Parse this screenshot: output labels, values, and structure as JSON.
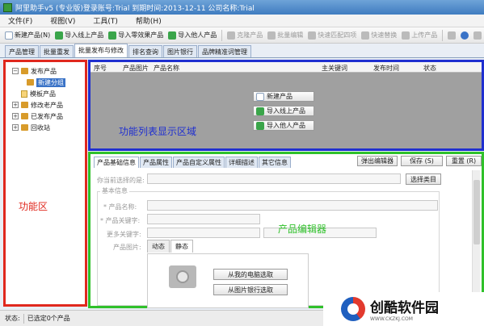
{
  "window": {
    "title": "阿里助手v5 (专业版)登录账号:Trial  到期时间:2013-12-11   公司名称:Trial"
  },
  "menu": [
    "文件(F)",
    "视图(V)",
    "工具(T)",
    "帮助(H)"
  ],
  "toolbar": {
    "new_product": "新建产品(N)",
    "import_online": "导入线上产品",
    "import_effect": "导入零效果产品",
    "import_others": "导入他人产品",
    "clone_product": "克隆产品",
    "batch_edit": "批量编辑",
    "quick_match": "快速匹配四项",
    "quick_replace": "快速替换",
    "upload_product": "上传产品"
  },
  "main_tabs": [
    "产品管理",
    "批量重发",
    "批量发布与修改",
    "排名查询",
    "图片银行",
    "品牌精准词管理"
  ],
  "tree": {
    "items": [
      "发布产品",
      "新建分组",
      "模板产品",
      "修改老产品",
      "已发布产品",
      "回收站"
    ]
  },
  "left_label": "功能区",
  "list": {
    "columns": [
      "序号",
      "产品图片",
      "产品名称",
      "主关键词",
      "发布时间",
      "状态"
    ],
    "buttons": [
      "新建产品",
      "导入线上产品",
      "导入他人产品"
    ],
    "area_label": "功能列表显示区域"
  },
  "editor": {
    "tabs": [
      "产品基础信息",
      "产品属性",
      "产品自定义属性",
      "详细描述",
      "其它信息"
    ],
    "popup_editor": "弹出编辑器",
    "save": "保存 (S)",
    "reset": "重置 (R)",
    "category_placeholder": "你当前选择的是:",
    "select_category": "选择类目",
    "basic_info": "基本信息",
    "product_name": "* 产品名称:",
    "product_keyword": "* 产品关键字:",
    "more_keywords": "更多关键字:",
    "product_image": "产品图片:",
    "image_tabs": [
      "动态",
      "静态"
    ],
    "from_computer": "从我的电脑选取",
    "from_bank": "从图片银行选取",
    "area_label": "产品编辑器"
  },
  "status": {
    "label": "状态:",
    "text": "已选定0个产品"
  },
  "watermark": {
    "name": "创酷软件园",
    "url": "WWW.CKZKJ.COM"
  }
}
